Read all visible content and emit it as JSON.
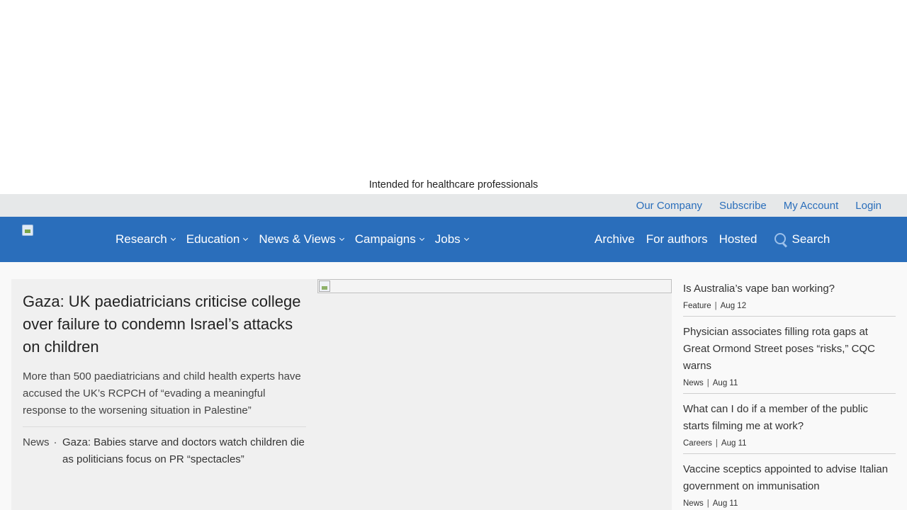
{
  "banner": {
    "intended_text": "Intended for healthcare professionals"
  },
  "utility_links": [
    "Our Company",
    "Subscribe",
    "My Account",
    "Login"
  ],
  "colors": {
    "brand_blue": "#2a6ebb",
    "utility_bar": "#e6e8e9",
    "link_blue": "#2a6ebb"
  },
  "nav": {
    "menu": [
      {
        "label": "Research",
        "icon": "chevron-down-icon"
      },
      {
        "label": "Education",
        "icon": "chevron-down-icon"
      },
      {
        "label": "News & Views",
        "icon": "chevron-down-icon"
      },
      {
        "label": "Campaigns",
        "icon": "chevron-down-icon"
      },
      {
        "label": "Jobs",
        "icon": "chevron-down-icon"
      }
    ],
    "links": [
      "Archive",
      "For authors",
      "Hosted"
    ],
    "search_label": "Search",
    "search_icon": "search-icon"
  },
  "lead": {
    "title": "Gaza: UK paediatricians criticise college over failure to condemn Israel’s attacks on children",
    "standfirst": "More than 500 paediatricians and child health experts have accused the UK’s RCPCH of “evading a meaningful response to the worsening situation in Palestine”",
    "related": {
      "type": "News",
      "separator": "·",
      "title": "Gaza: Babies starve and doctors watch children die as politicians focus on PR “spectacles”"
    }
  },
  "sidebar": {
    "items": [
      {
        "title": "Is Australia’s vape ban working?",
        "type": "Feature",
        "date": "Aug 12"
      },
      {
        "title": "Physician associates filling rota gaps at Great Ormond Street poses “risks,” CQC warns",
        "type": "News",
        "date": "Aug 11"
      },
      {
        "title": "What can I do if a member of the public starts filming me at work?",
        "type": "Careers",
        "date": "Aug 11"
      },
      {
        "title": "Vaccine sceptics appointed to advise Italian government on immunisation",
        "type": "News",
        "date": "Aug 11"
      }
    ],
    "meta_separator": "|"
  }
}
